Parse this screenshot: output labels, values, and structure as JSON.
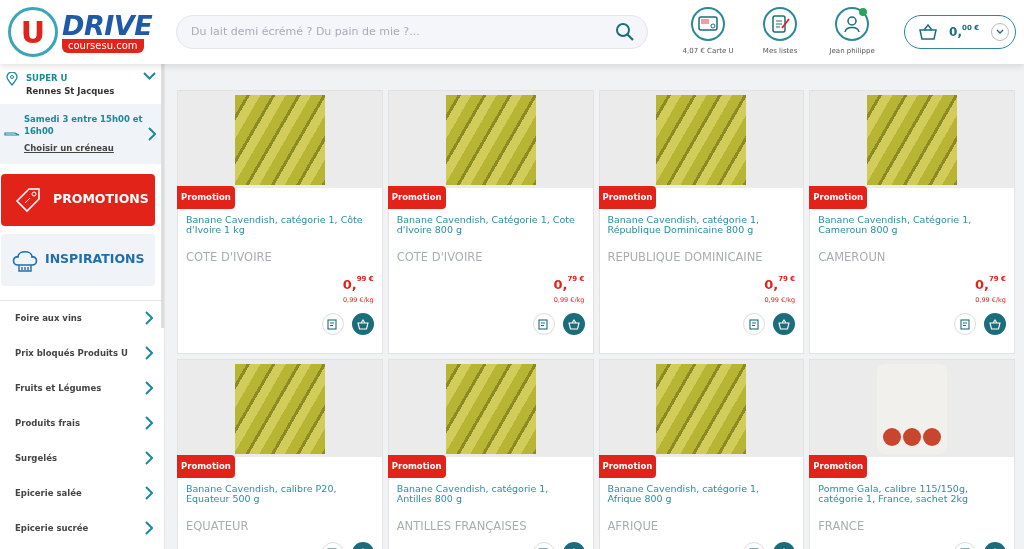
{
  "header": {
    "logo": {
      "letter": "U",
      "word": "DRIVE",
      "domain": "coursesu.com"
    },
    "search": {
      "placeholder": "Du lait demi écrémé ? Du pain de mie ?..."
    },
    "actions": [
      {
        "kind": "card",
        "label": "4,07 € Carte U",
        "notify": false
      },
      {
        "kind": "lists",
        "label": "Mes listes",
        "notify": false
      },
      {
        "kind": "account",
        "label": "Jean philippe",
        "notify": true
      }
    ],
    "cart": {
      "units": "0,",
      "cents": "00 €"
    }
  },
  "sidebar": {
    "store": {
      "name": "SUPER U",
      "city": "Rennes St Jacques"
    },
    "slot": {
      "text": "Samedi 3 entre 15h00 et 16h00",
      "link": "Choisir un créneau"
    },
    "promotions": "PROMOTIONS",
    "inspirations": "INSPIRATIONS",
    "categories": [
      "Foire aux vins",
      "Prix bloqués Produits U",
      "Fruits et Légumes",
      "Produits frais",
      "Surgelés",
      "Epicerie salée",
      "Epicerie sucrée"
    ]
  },
  "products": [
    {
      "kind": "bananas",
      "badge": "Promotion",
      "title": "Banane Cavendish, catégorie 1, Côte d'Ivoire 1 kg",
      "origin": "COTE D'IVOIRE",
      "price_units": "0,",
      "price_cents": "99 €",
      "unit_price": "0,99 €/kg"
    },
    {
      "kind": "bananas",
      "badge": "Promotion",
      "title": "Banane Cavendish, Catégorie 1, Cote d'Ivoire 800 g",
      "origin": "COTE D'IVOIRE",
      "price_units": "0,",
      "price_cents": "79 €",
      "unit_price": "0,99 €/kg"
    },
    {
      "kind": "bananas",
      "badge": "Promotion",
      "title": "Banane Cavendish, catégorie 1, République Dominicaine 800 g",
      "origin": "REPUBLIQUE DOMINICAINE",
      "price_units": "0,",
      "price_cents": "79 €",
      "unit_price": "0,99 €/kg"
    },
    {
      "kind": "bananas",
      "badge": "Promotion",
      "title": "Banane Cavendish, Catégorie 1, Cameroun 800 g",
      "origin": "CAMEROUN",
      "price_units": "0,",
      "price_cents": "79 €",
      "unit_price": "0,99 €/kg"
    },
    {
      "kind": "bananas",
      "badge": "Promotion",
      "title": "Banane Cavendish, calibre P20, Equateur 500 g",
      "origin": "EQUATEUR"
    },
    {
      "kind": "bananas",
      "badge": "Promotion",
      "title": "Banane Cavendish, catégorie 1, Antilles 800 g",
      "origin": "ANTILLES FRANÇAISES"
    },
    {
      "kind": "bananas",
      "badge": "Promotion",
      "title": "Banane Cavendish, catégorie 1, Afrique 800 g",
      "origin": "AFRIQUE"
    },
    {
      "kind": "apples",
      "badge": "Promotion",
      "title": "Pomme Gala, calibre 115/150g, catégorie 1, France, sachet 2kg",
      "origin": "FRANCE"
    }
  ]
}
